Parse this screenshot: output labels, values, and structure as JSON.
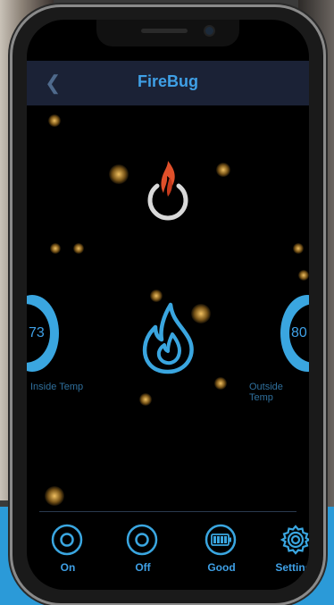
{
  "header": {
    "title": "FireBug",
    "back_icon": "chevron-left-icon"
  },
  "gauges": {
    "inside": {
      "value": "73",
      "label": "Inside Temp"
    },
    "outside": {
      "value": "80",
      "label": "Outside Temp"
    }
  },
  "tabs": [
    {
      "label": "On",
      "icon": "radio-circle-icon"
    },
    {
      "label": "Off",
      "icon": "radio-circle-icon"
    },
    {
      "label": "Good",
      "icon": "battery-icon"
    },
    {
      "label": "Settings",
      "icon": "gear-icon"
    }
  ],
  "colors": {
    "accent": "#3fa0e6",
    "header_bg": "#1b2236",
    "flame": "#e0502a"
  }
}
